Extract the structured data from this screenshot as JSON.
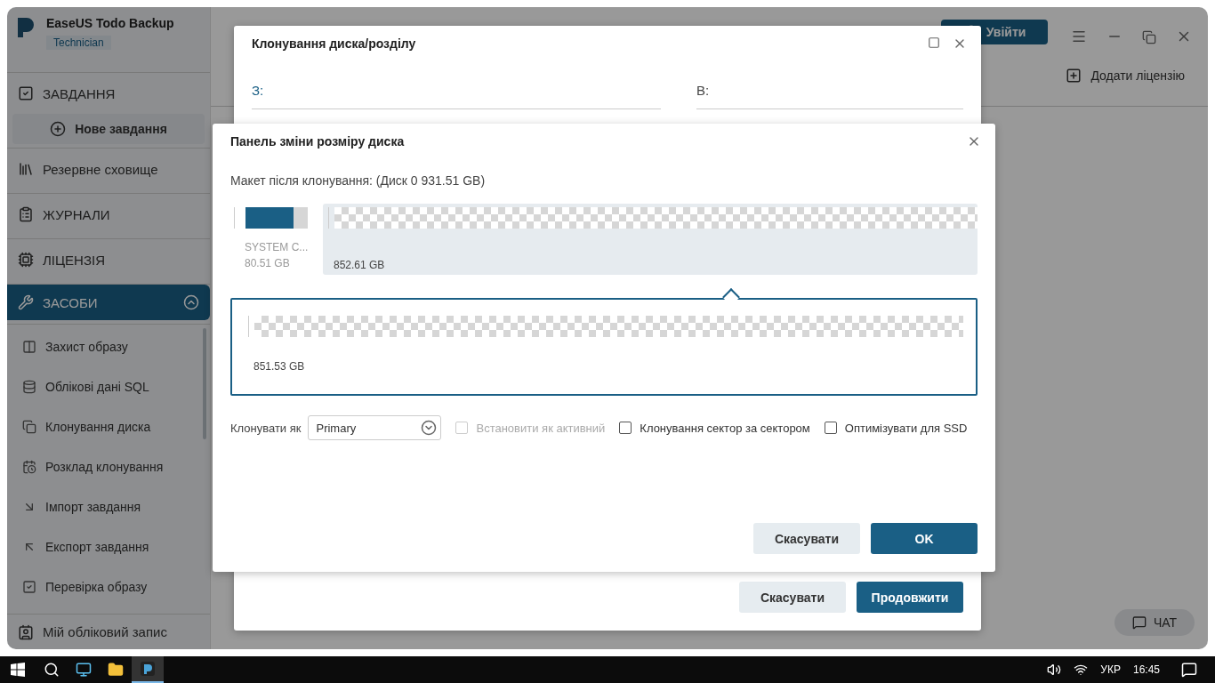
{
  "app": {
    "title": "EaseUS Todo Backup",
    "edition": "Technician",
    "login_button": "Увійти",
    "add_license": "Додати ліцензію",
    "chat_button": "ЧАТ"
  },
  "sidebar": {
    "items": [
      {
        "label": "ЗАВДАННЯ",
        "selected": false,
        "action": "Нове завдання"
      },
      {
        "label": "Резервне сховище",
        "selected": false
      },
      {
        "label": "ЖУРНАЛИ",
        "selected": false
      },
      {
        "label": "ЛІЦЕНЗІЯ",
        "selected": false
      },
      {
        "label": "ЗАСОБИ",
        "selected": true,
        "expanded": true,
        "children": [
          "Захист образу",
          "Облікові дані SQL",
          "Клонування диска",
          "Розклад клонування",
          "Імпорт завдання",
          "Експорт завдання",
          "Перевірка образу"
        ]
      }
    ],
    "account": "Мій обліковий запис"
  },
  "clone_dialog": {
    "title": "Клонування диска/розділу",
    "from_label": "З:",
    "to_label": "В:",
    "buttons": [
      {
        "label": "Скасувати",
        "kind": "secondary"
      },
      {
        "label": "Продовжити",
        "kind": "primary"
      }
    ]
  },
  "resize_dialog": {
    "title": "Панель зміни розміру диска",
    "layout_label": "Макет після клонування: (Диск 0 931.51 GB)",
    "source_partitions": [
      {
        "kind": "used",
        "label": "SYSTEM C...",
        "size": "80.51 GB",
        "level": 0.77,
        "selected": false
      },
      {
        "kind": "unallocated",
        "size": "852.61 GB",
        "selected": true
      }
    ],
    "target_partition": {
      "size": "851.53 GB"
    },
    "clone_as_label": "Клонувати як",
    "clone_as_value": "Primary",
    "options": [
      {
        "label": "Встановити як активний",
        "checked": false,
        "disabled": true
      },
      {
        "label": "Клонування сектор за сектором",
        "checked": false,
        "disabled": false
      },
      {
        "label": "Оптимізувати для SSD",
        "checked": false,
        "disabled": false
      }
    ],
    "buttons": [
      {
        "label": "Скасувати",
        "kind": "secondary"
      },
      {
        "label": "OK",
        "kind": "primary"
      }
    ]
  },
  "taskbar": {
    "language": "УКР",
    "time": "16:45"
  }
}
